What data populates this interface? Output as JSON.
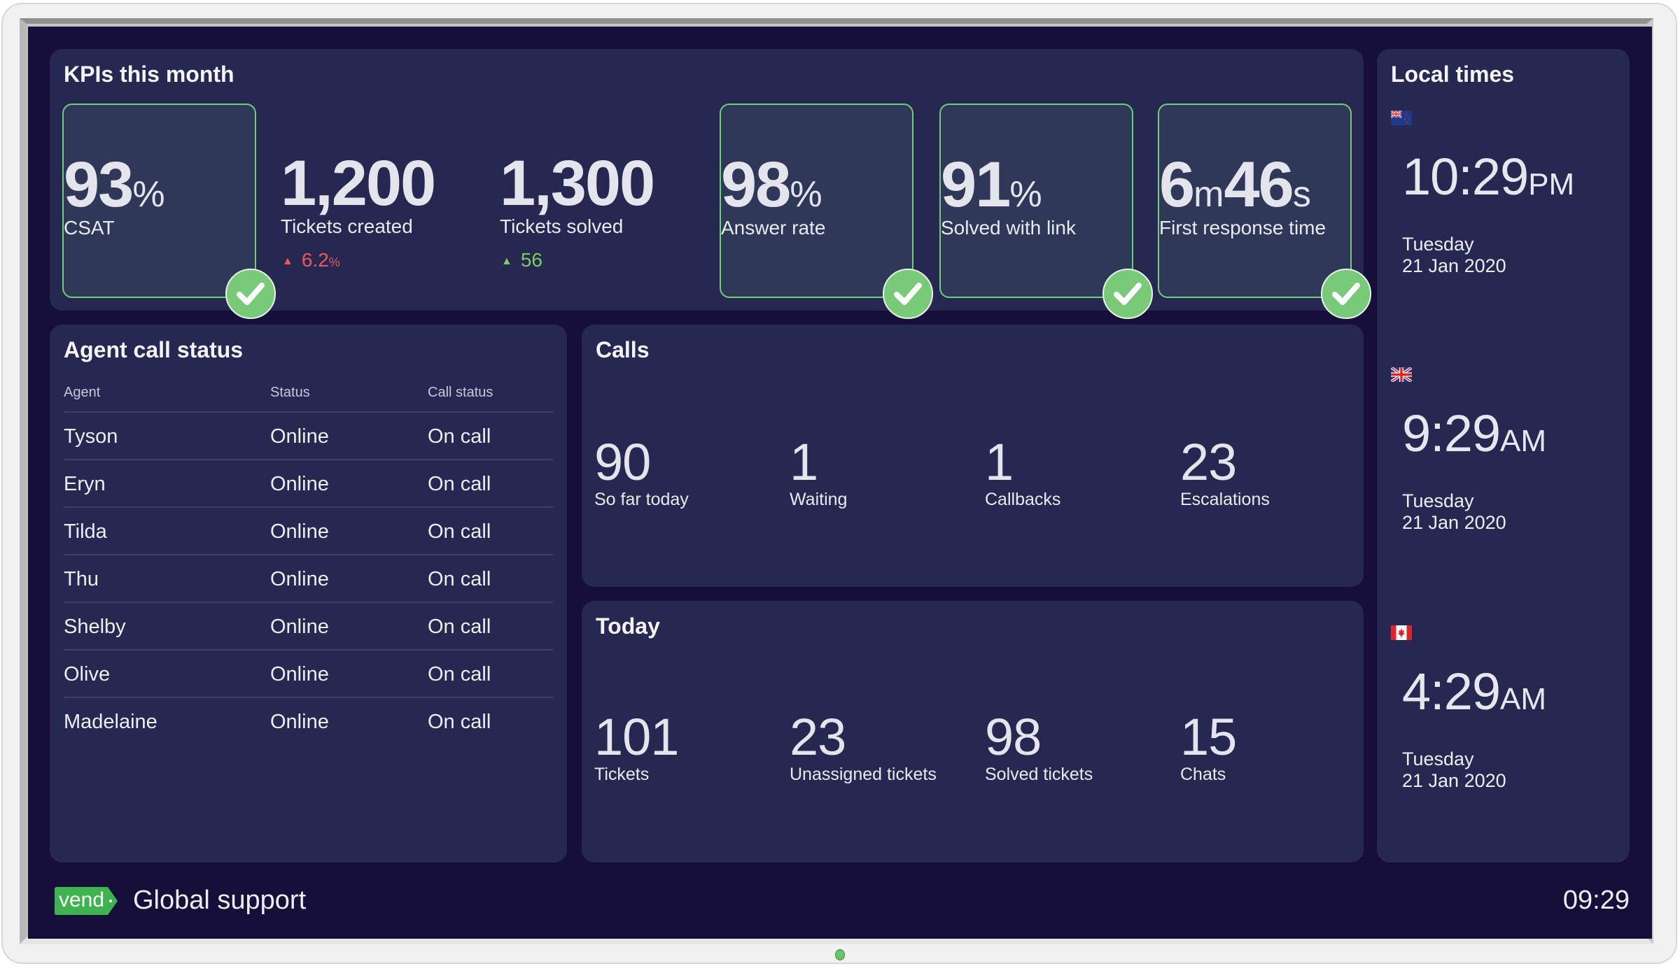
{
  "kpis": {
    "title": "KPIs this month",
    "tiles": [
      {
        "value": "93",
        "unit": "%",
        "label": "CSAT",
        "boxed": true,
        "check": true
      },
      {
        "value": "1,200",
        "unit": "",
        "label": "Tickets created",
        "trend": {
          "direction": "up",
          "value": "6.2",
          "unit": "%",
          "color": "#e65a5a"
        }
      },
      {
        "value": "1,300",
        "unit": "",
        "label": "Tickets solved",
        "trend": {
          "direction": "up",
          "value": "56",
          "unit": "",
          "color": "#7fcb5f"
        }
      },
      {
        "value": "98",
        "unit": "%",
        "label": "Answer rate",
        "boxed": true,
        "check": true
      },
      {
        "value": "91",
        "unit": "%",
        "label": "Solved with link",
        "boxed": true,
        "check": true
      },
      {
        "value_parts": [
          "6",
          "m",
          "46",
          "s"
        ],
        "label": "First response time",
        "boxed": true,
        "check": true
      }
    ]
  },
  "agents": {
    "title": "Agent call status",
    "columns": [
      "Agent",
      "Status",
      "Call status"
    ],
    "rows": [
      [
        "Tyson",
        "Online",
        "On call"
      ],
      [
        "Eryn",
        "Online",
        "On call"
      ],
      [
        "Tilda",
        "Online",
        "On call"
      ],
      [
        "Thu",
        "Online",
        "On call"
      ],
      [
        "Shelby",
        "Online",
        "On call"
      ],
      [
        "Olive",
        "Online",
        "On call"
      ],
      [
        "Madelaine",
        "Online",
        "On call"
      ]
    ]
  },
  "calls": {
    "title": "Calls",
    "stats": [
      {
        "value": "90",
        "label": "So far today"
      },
      {
        "value": "1",
        "label": "Waiting"
      },
      {
        "value": "1",
        "label": "Callbacks"
      },
      {
        "value": "23",
        "label": "Escalations"
      }
    ]
  },
  "today": {
    "title": "Today",
    "stats": [
      {
        "value": "101",
        "label": "Tickets"
      },
      {
        "value": "23",
        "label": "Unassigned tickets"
      },
      {
        "value": "98",
        "label": "Solved tickets"
      },
      {
        "value": "15",
        "label": "Chats"
      }
    ]
  },
  "local_times": {
    "title": "Local times",
    "zones": [
      {
        "flag": "new-zealand-flag-icon",
        "time": "10:29",
        "ampm": "PM",
        "day": "Tuesday",
        "date": "21 Jan 2020"
      },
      {
        "flag": "uk-flag-icon",
        "time": "9:29",
        "ampm": "AM",
        "day": "Tuesday",
        "date": "21 Jan 2020"
      },
      {
        "flag": "canada-flag-icon",
        "time": "4:29",
        "ampm": "AM",
        "day": "Tuesday",
        "date": "21 Jan 2020"
      }
    ]
  },
  "footer": {
    "logo_text": "vend",
    "title": "Global support",
    "clock": "09:29"
  },
  "colors": {
    "background": "#160f3a",
    "panel": "#272851",
    "tile": "#2f3859",
    "success": "#78c978",
    "trend_up_bad": "#e65a5a",
    "trend_up_good": "#7fcb5f",
    "brand": "#3eb34f"
  }
}
